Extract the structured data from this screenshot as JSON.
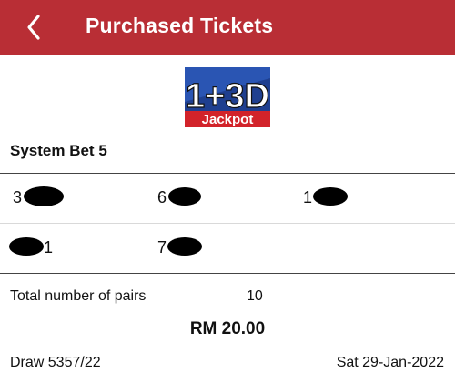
{
  "header": {
    "back_icon": "chevron-left-icon",
    "title": "Purchased Tickets",
    "background": "#b92e35"
  },
  "logo": {
    "main": "1+3D",
    "sub": "Jackpot"
  },
  "bet": {
    "title": "System Bet 5"
  },
  "numbers": [
    {
      "visible": "3",
      "redacted": true
    },
    {
      "visible": "6",
      "redacted": true
    },
    {
      "visible": "1",
      "redacted": true
    },
    {
      "visible": "1",
      "redacted": true
    },
    {
      "visible": "7",
      "redacted": true
    }
  ],
  "summary": {
    "pairs_label": "Total number of pairs",
    "pairs_value": "10",
    "amount": "RM 20.00"
  },
  "footer": {
    "draw": "Draw 5357/22",
    "date": "Sat 29-Jan-2022"
  }
}
